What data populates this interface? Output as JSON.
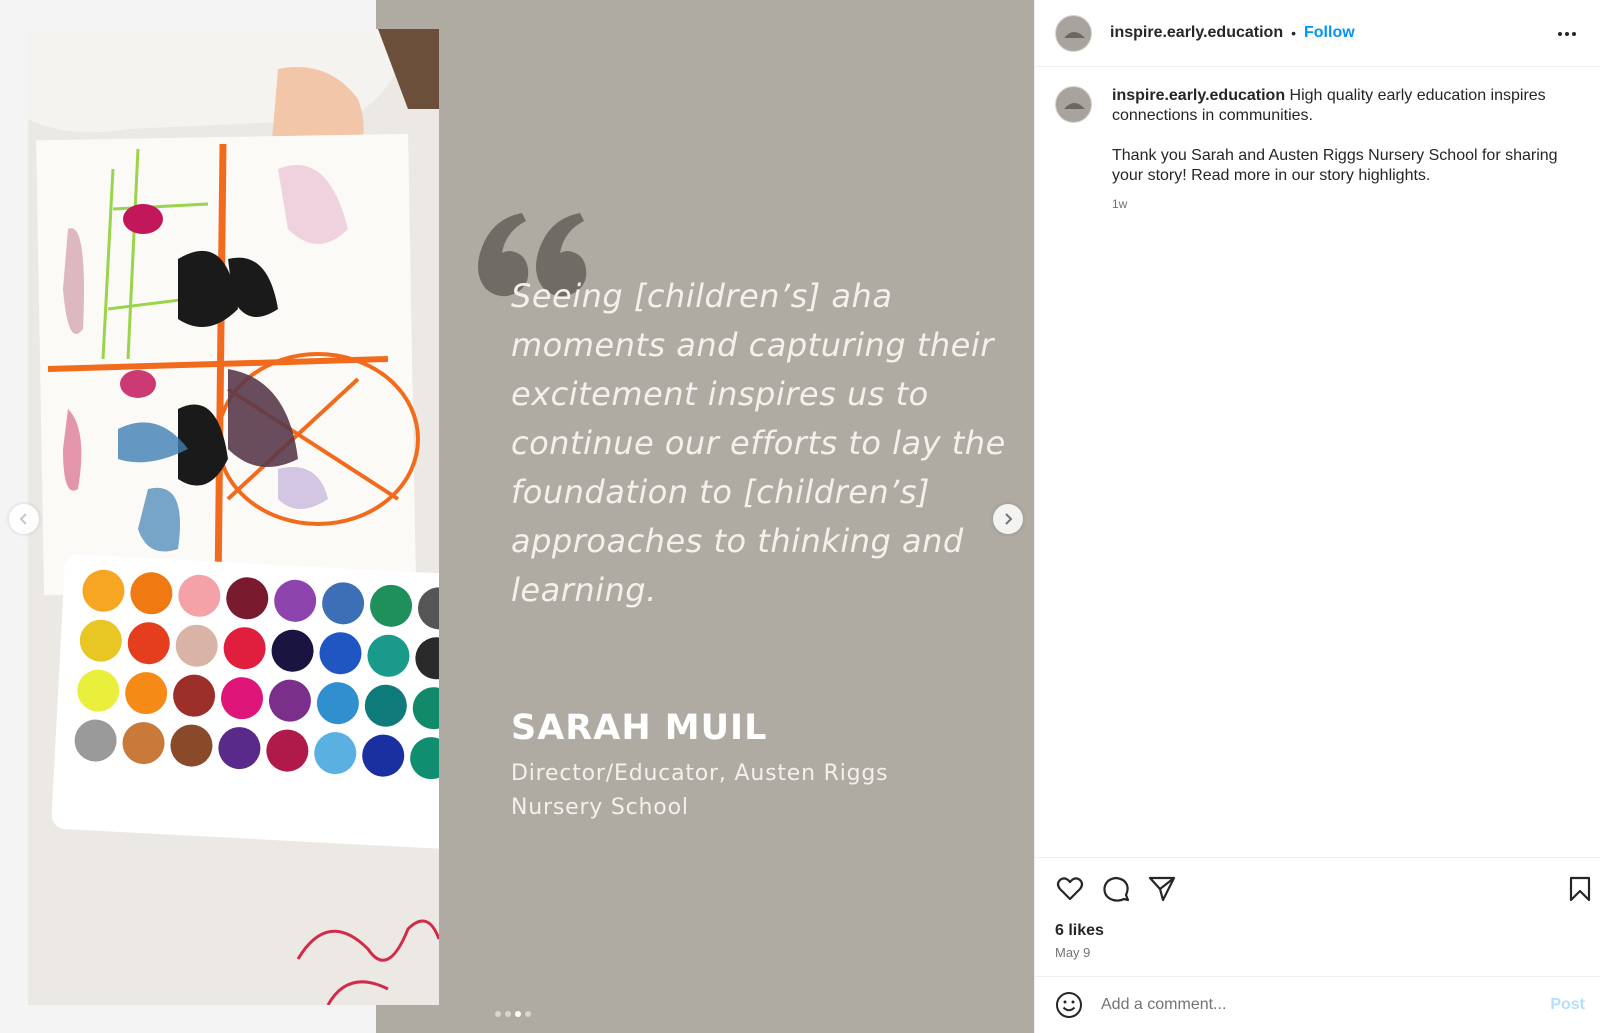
{
  "slide": {
    "quote": "Seeing [children’s] aha moments and capturing their excitement inspires us to continue our efforts to lay the foundation to [children’s] approaches to thinking and learning.",
    "author_name": "SARAH MUIL",
    "author_role": "Director/Educator, Austen Riggs Nursery School",
    "background_color": "#b0aba2",
    "dots_total": 4,
    "dot_active_index": 2
  },
  "header": {
    "username": "inspire.early.education",
    "separator": "•",
    "follow_label": "Follow"
  },
  "caption": {
    "username": "inspire.early.education",
    "text": " High quality early education inspires connections in communities.",
    "paragraph2": "Thank you Sarah and Austen Riggs Nursery School for sharing your story! Read more in our story highlights.",
    "time_ago": "1w"
  },
  "actions": {
    "like_icon": "heart-icon",
    "comment_icon": "comment-icon",
    "share_icon": "share-icon",
    "save_icon": "bookmark-icon"
  },
  "likes_text": "6 likes",
  "post_date": "May 9",
  "comment": {
    "placeholder": "Add a comment...",
    "post_label": "Post"
  },
  "colors": {
    "accent": "#0095f6",
    "post_disabled": "#b2dffc",
    "secondary_text": "#737373"
  }
}
